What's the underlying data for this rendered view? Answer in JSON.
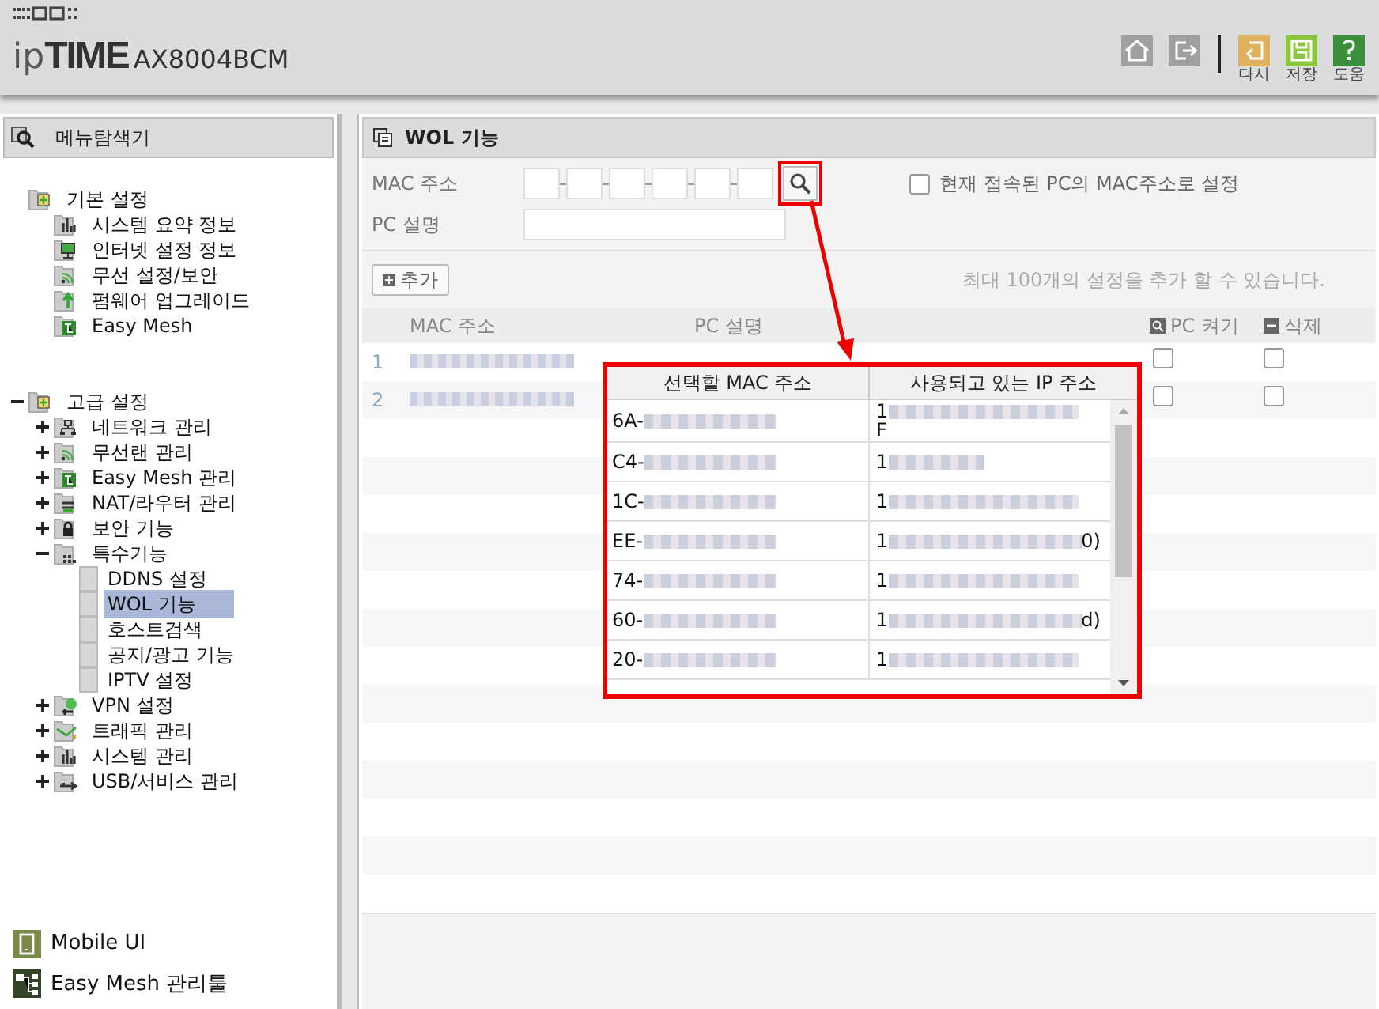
{
  "header": {
    "brand_prefix": "ip",
    "brand_name": "TIME",
    "model": "AX8004BCM",
    "toolbar": [
      {
        "kind": "home"
      },
      {
        "kind": "logout"
      },
      {
        "kind": "undo",
        "label": "다시"
      },
      {
        "kind": "save",
        "label": "저장"
      },
      {
        "kind": "help",
        "label": "도움"
      }
    ]
  },
  "sidebar": {
    "title": "메뉴탐색기",
    "tree": [
      {
        "label": "기본 설정",
        "kind": "folder",
        "selected": false,
        "children": [
          {
            "label": "시스템 요약 정보",
            "kind": "chart",
            "selected": false
          },
          {
            "label": "인터넷 설정 정보",
            "kind": "monitor",
            "selected": false
          },
          {
            "label": "무선 설정/보안",
            "kind": "wifi",
            "selected": false
          },
          {
            "label": "펌웨어 업그레이드",
            "kind": "upgrade",
            "selected": false
          },
          {
            "label": "Easy Mesh",
            "kind": "mesh",
            "selected": false
          }
        ]
      },
      {
        "label": "고급 설정",
        "kind": "folder",
        "expanded": true,
        "selected": false,
        "children": [
          {
            "label": "네트워크 관리",
            "kind": "network",
            "expanded": false,
            "selected": false
          },
          {
            "label": "무선랜 관리",
            "kind": "wifi",
            "expanded": false,
            "selected": false
          },
          {
            "label": "Easy Mesh 관리",
            "kind": "mesh",
            "expanded": false,
            "selected": false
          },
          {
            "label": "NAT/라우터 관리",
            "kind": "nat",
            "expanded": false,
            "selected": false
          },
          {
            "label": "보안 기능",
            "kind": "lock",
            "expanded": false,
            "selected": false
          },
          {
            "label": "특수기능",
            "kind": "special",
            "expanded": true,
            "selected": false,
            "children": [
              {
                "label": "DDNS 설정",
                "kind": "page",
                "selected": false
              },
              {
                "label": "WOL 기능",
                "kind": "page",
                "selected": true
              },
              {
                "label": "호스트검색",
                "kind": "page",
                "selected": false
              },
              {
                "label": "공지/광고 기능",
                "kind": "page",
                "selected": false
              },
              {
                "label": "IPTV 설정",
                "kind": "page",
                "selected": false
              }
            ]
          },
          {
            "label": "VPN 설정",
            "kind": "vpn",
            "expanded": false,
            "selected": false
          },
          {
            "label": "트래픽 관리",
            "kind": "traffic",
            "expanded": false,
            "selected": false
          },
          {
            "label": "시스템 관리",
            "kind": "chart",
            "expanded": false,
            "selected": false
          },
          {
            "label": "USB/서비스 관리",
            "kind": "usb",
            "expanded": false,
            "selected": false
          }
        ]
      }
    ],
    "footer_links": [
      {
        "kind": "mobile",
        "label": "Mobile UI"
      },
      {
        "kind": "mesh",
        "label": "Easy Mesh 관리툴"
      }
    ]
  },
  "main": {
    "title": "WOL 기능",
    "mac_label": "MAC 주소",
    "pc_label": "PC 설명",
    "use_current_pc": {
      "label": "현재 접속된 PC의 MAC주소로 설정",
      "checked": false
    },
    "add_button": "추가",
    "note": "최대 100개의 설정을 추가 할 수 있습니다.",
    "table": {
      "columns": [
        "MAC 주소",
        "PC 설명",
        "PC 켜기",
        "삭제"
      ],
      "rows": [
        {
          "index": "1",
          "redacted": true,
          "wake": false,
          "delete": false
        },
        {
          "index": "2",
          "redacted": true,
          "wake": false,
          "delete": false
        }
      ]
    }
  },
  "popup": {
    "columns": [
      "선택할 MAC 주소",
      "사용되고 있는 IP 주소"
    ],
    "rows": [
      {
        "mac": "6A-",
        "ip": "1",
        "ip_line2": "F",
        "redacted": true
      },
      {
        "mac": "C4-",
        "ip": "1",
        "redacted": true
      },
      {
        "mac": "1C-",
        "ip": "1",
        "redacted": true
      },
      {
        "mac": "EE-",
        "ip": "1",
        "ip_tail": "0)",
        "redacted": true
      },
      {
        "mac": "74-",
        "ip": "1",
        "redacted": true
      },
      {
        "mac": "60-",
        "ip": "1",
        "ip_tail": "d)",
        "redacted": true
      },
      {
        "mac": "20-",
        "ip": "1",
        "redacted": true
      }
    ]
  }
}
